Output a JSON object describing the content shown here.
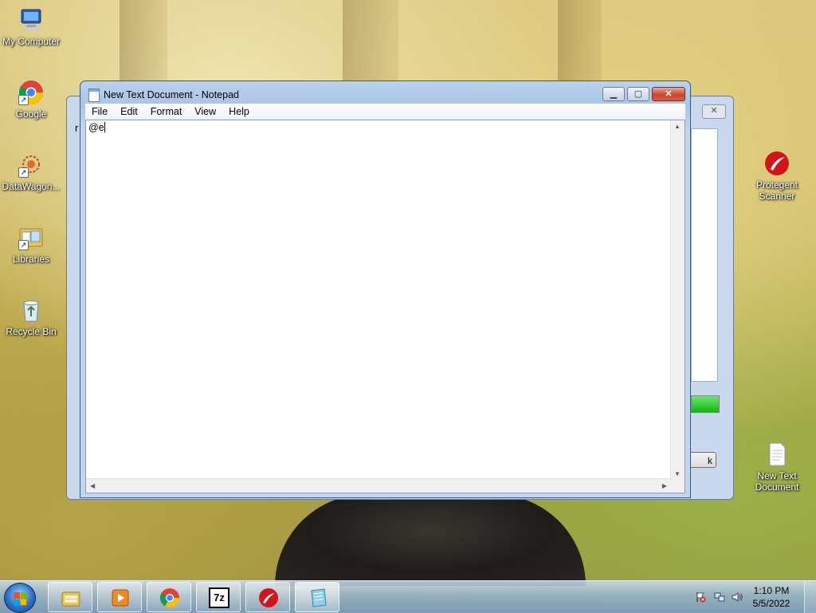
{
  "desktop": {
    "icons_left": [
      {
        "label": "My Computer",
        "icon": "computer-icon",
        "shortcut": false
      },
      {
        "label": "Google",
        "icon": "chrome-icon",
        "shortcut": true
      },
      {
        "label": "DataWagon...",
        "icon": "datawagon-icon",
        "shortcut": true
      },
      {
        "label": "Libraries",
        "icon": "libraries-icon",
        "shortcut": true
      },
      {
        "label": "Recycle Bin",
        "icon": "recycle-bin-icon",
        "shortcut": false
      }
    ],
    "icons_right": [
      {
        "label": "Protegent Scanner",
        "icon": "protegent-icon"
      },
      {
        "label": "New Text Document",
        "icon": "text-document-icon"
      }
    ]
  },
  "background_window": {
    "stray_char": "r",
    "button_fragment": "k",
    "close_glyph": "✕"
  },
  "notepad": {
    "title": "New Text Document - Notepad",
    "menu": [
      "File",
      "Edit",
      "Format",
      "View",
      "Help"
    ],
    "content": "@e",
    "buttons": {
      "minimize": "▁",
      "maximize": "▢",
      "close": "✕"
    },
    "scroll_glyphs": {
      "up": "▲",
      "down": "▼",
      "left": "◀",
      "right": "▶"
    }
  },
  "taskbar": {
    "pinned": [
      "explorer-icon",
      "media-player-icon",
      "chrome-icon",
      "7zip-icon",
      "protegent-icon",
      "notepad-icon"
    ],
    "sevenzip_label": "7z",
    "clock": {
      "time": "1:10 PM",
      "date": "5/5/2022"
    },
    "tray_icons": [
      "action-center-icon",
      "network-icon",
      "volume-icon"
    ],
    "colors": {
      "start_flag": [
        "#f25022",
        "#7fba00",
        "#00a4ef",
        "#ffb900"
      ]
    }
  }
}
